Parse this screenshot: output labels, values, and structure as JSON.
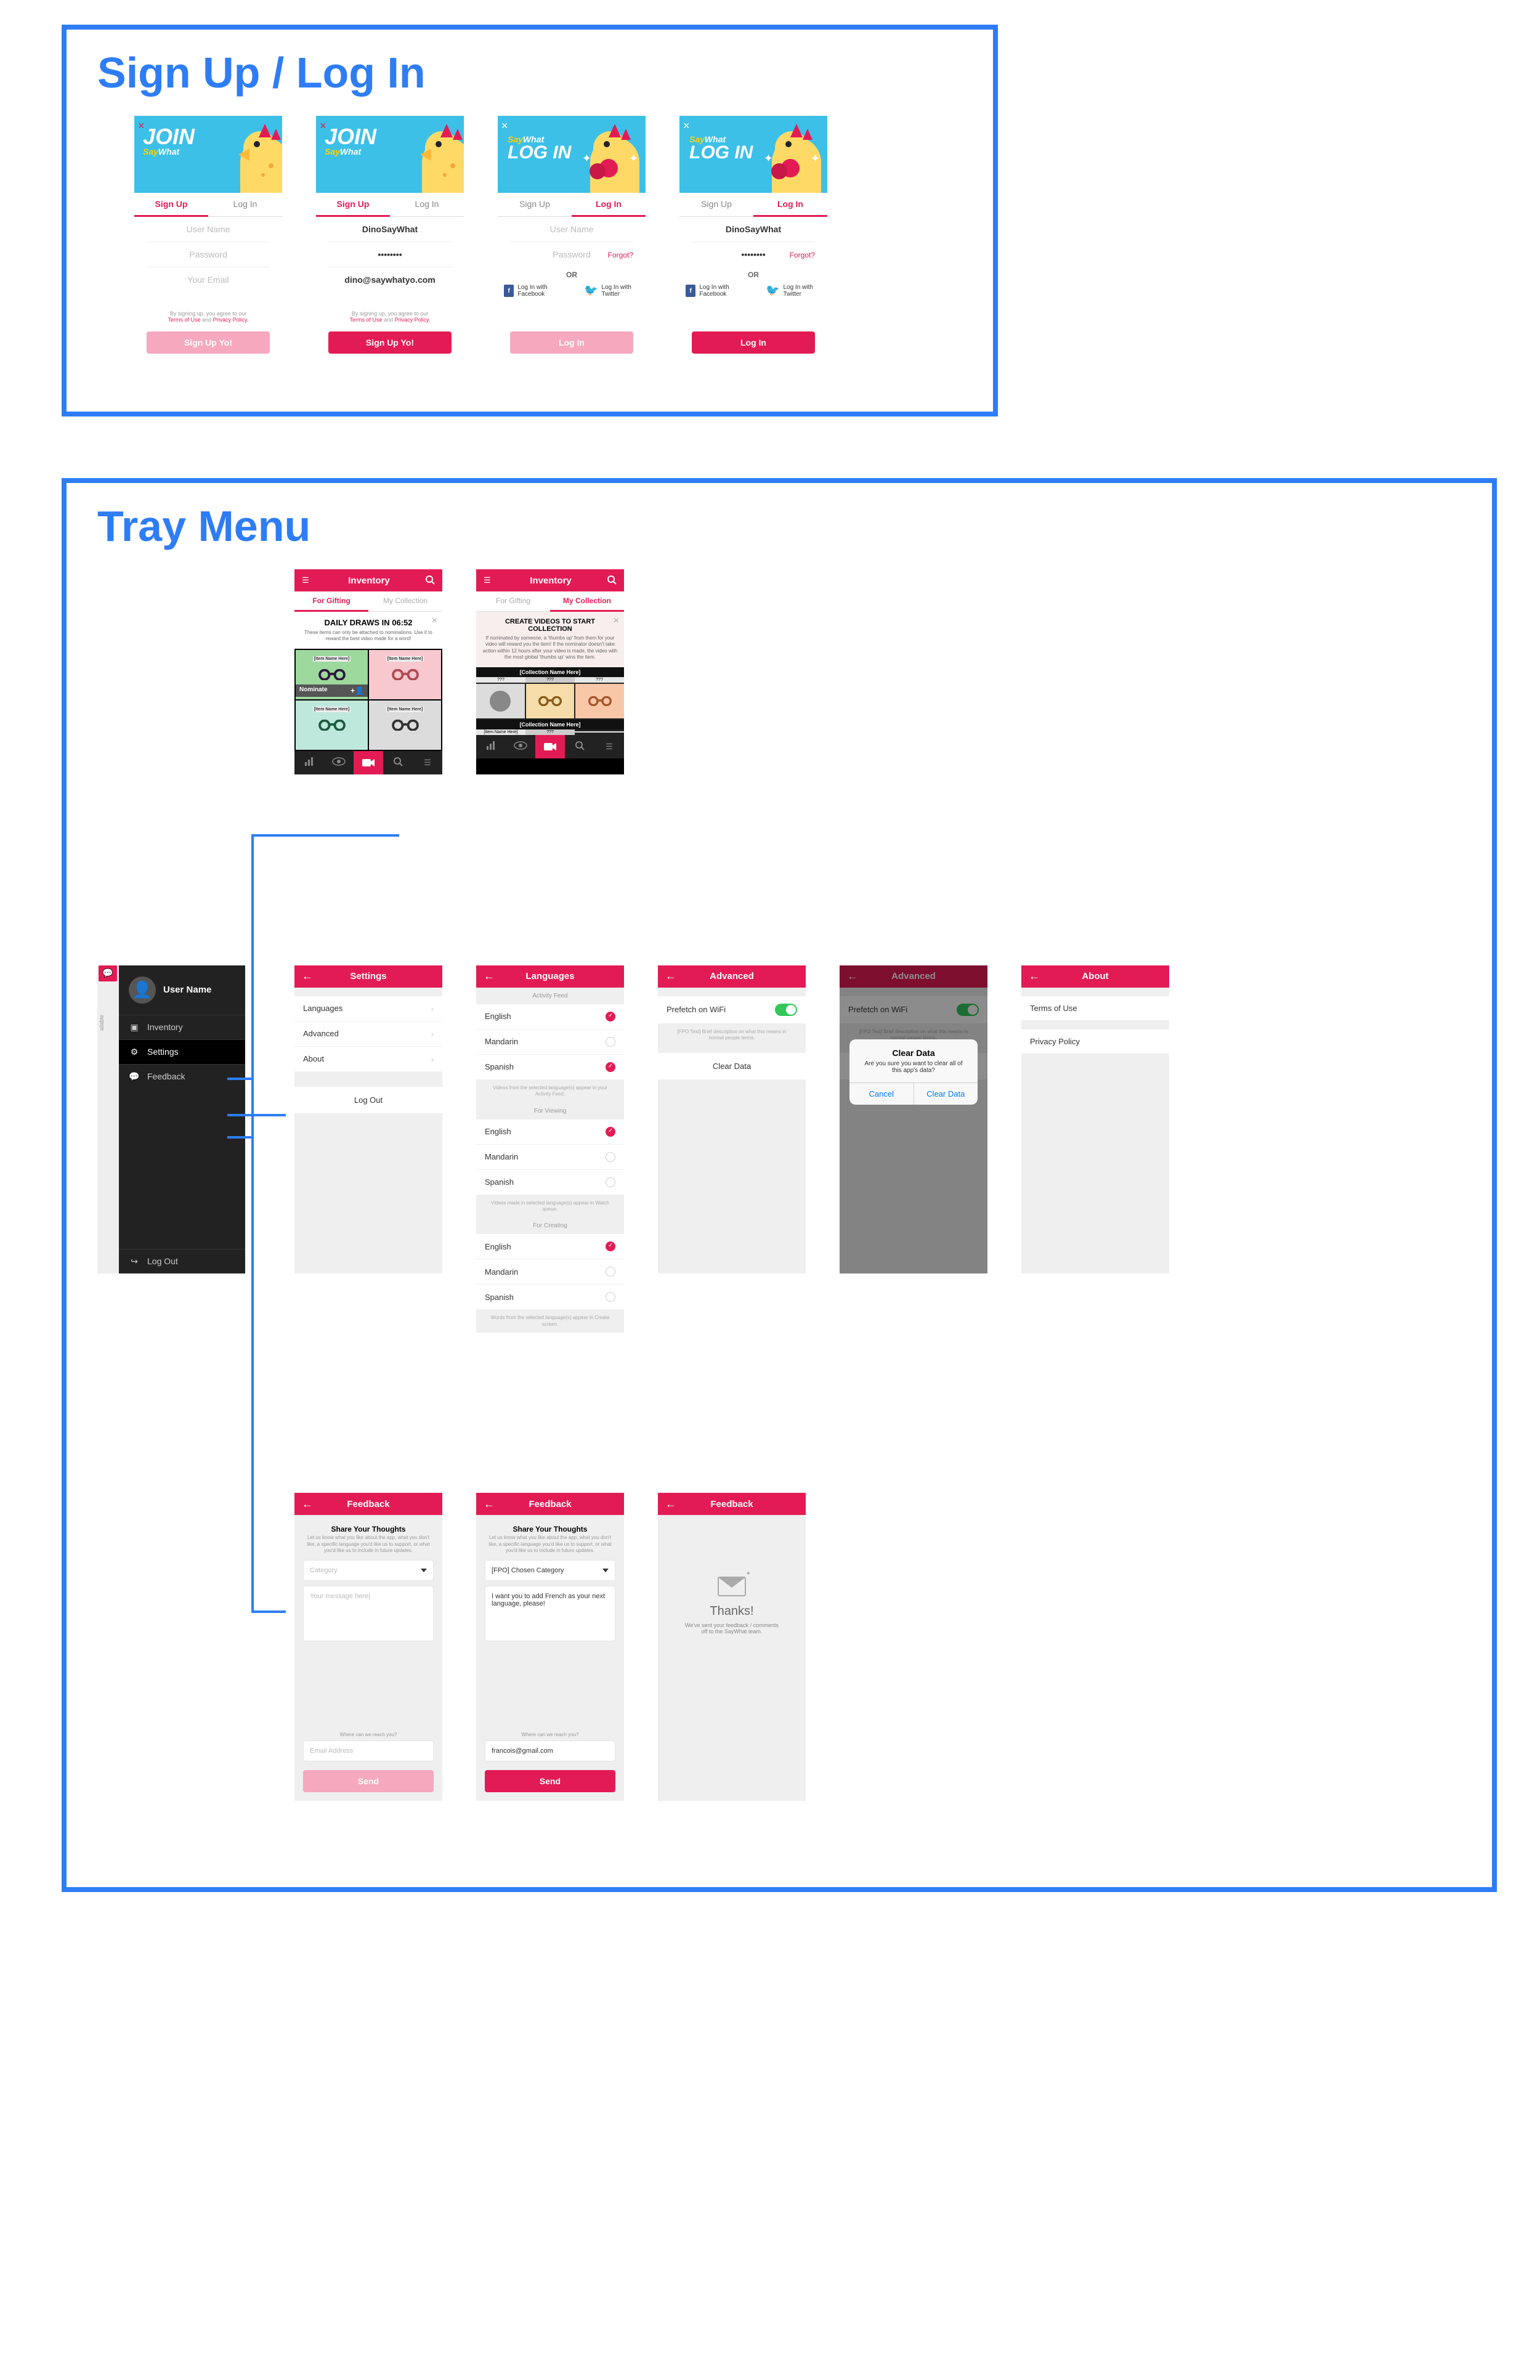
{
  "sections": {
    "auth": "Sign Up / Log In",
    "tray": "Tray Menu"
  },
  "auth": {
    "join": "JOIN",
    "say": "Say",
    "what": "What",
    "login": "LOG IN",
    "tabs": {
      "signup": "Sign Up",
      "login": "Log In"
    },
    "placeholders": {
      "username": "User Name",
      "password": "Password",
      "email": "Your Email"
    },
    "values": {
      "username": "DinoSayWhat",
      "password_masked": "••••••••",
      "email": "dino@saywhatyo.com"
    },
    "forgot": "Forgot?",
    "or": "OR",
    "social": {
      "fb": "Log In with Facebook",
      "tw": "Log In with Twitter"
    },
    "terms": {
      "line1": "By signing up, you agree to our",
      "tos": "Terms of Use",
      "and": " and ",
      "pp": "Privacy Policy."
    },
    "buttons": {
      "signup": "Sign Up Yo!",
      "login": "Log In"
    }
  },
  "inventory": {
    "title": "Inventory",
    "tabs": {
      "gifting": "For Gifting",
      "collection": "My Collection"
    },
    "daily": {
      "title": "DAILY DRAWS IN 06:52",
      "sub": "These items can only be attached to nominations. Use it to reward the best video made for a word!"
    },
    "itemlabel": "[Item Name Here]",
    "nominate": "Nominate",
    "collection": {
      "title": "CREATE VIDEOS TO START COLLECTION",
      "sub": "If nominated by someone, a 'thumbs up' from them for your video will reward you the item!\nIf the nominator doesn't take action within 12 hours after your video is made, the video with the most global 'thumbs up' wins the item.",
      "collname": "[Collection Name Here]",
      "tag": "???"
    }
  },
  "tray": {
    "sliver": "ailable",
    "user": "User Name",
    "items": {
      "inventory": "Inventory",
      "settings": "Settings",
      "feedback": "Feedback",
      "logout": "Log Out"
    }
  },
  "settings": {
    "title": "Settings",
    "rows": {
      "languages": "Languages",
      "advanced": "Advanced",
      "about": "About"
    },
    "logout": "Log Out"
  },
  "languages": {
    "title": "Languages",
    "sections": {
      "feed": "Activity Feed",
      "viewing": "For Viewing",
      "creating": "For Creating"
    },
    "opts": {
      "en": "English",
      "md": "Mandarin",
      "sp": "Spanish"
    },
    "cap_feed": "Videos from the selected language(s) appear in your Activity Feed.",
    "cap_view": "Videos made in selected language(s) appear in Watch queue.",
    "cap_create": "Words from the selected language(s) appear in Create screen."
  },
  "advanced": {
    "title": "Advanced",
    "prefetch": "Prefetch on WiFi",
    "prefetch_desc": "[FPO Text] Brief description on what this means in normal people terms.",
    "clear": "Clear Data",
    "alert": {
      "title": "Clear Data",
      "msg": "Are you sure you want to clear all of this app's data?",
      "cancel": "Cancel",
      "ok": "Clear Data"
    }
  },
  "about": {
    "title": "About",
    "tos": "Terms of Use",
    "pp": "Privacy Policy"
  },
  "feedback": {
    "title": "Feedback",
    "header": "Share Your Thoughts",
    "sub": "Let us know what you like about the app, what you don't like, a specific language you'd like us to support, or what you'd like us to include in future updates.",
    "category_ph": "Category",
    "category_val": "[FPO] Chosen Category",
    "msg_ph": "Your message here|",
    "msg_val": "I want you to add French as your next language, please!",
    "reach": "Where can we reach you?",
    "email_ph": "Email Address",
    "email_val": "francois@gmail.com",
    "send": "Send",
    "thanks": {
      "title": "Thanks!",
      "msg": "We've sent your feedback / comments off to the SayWhat team."
    }
  }
}
